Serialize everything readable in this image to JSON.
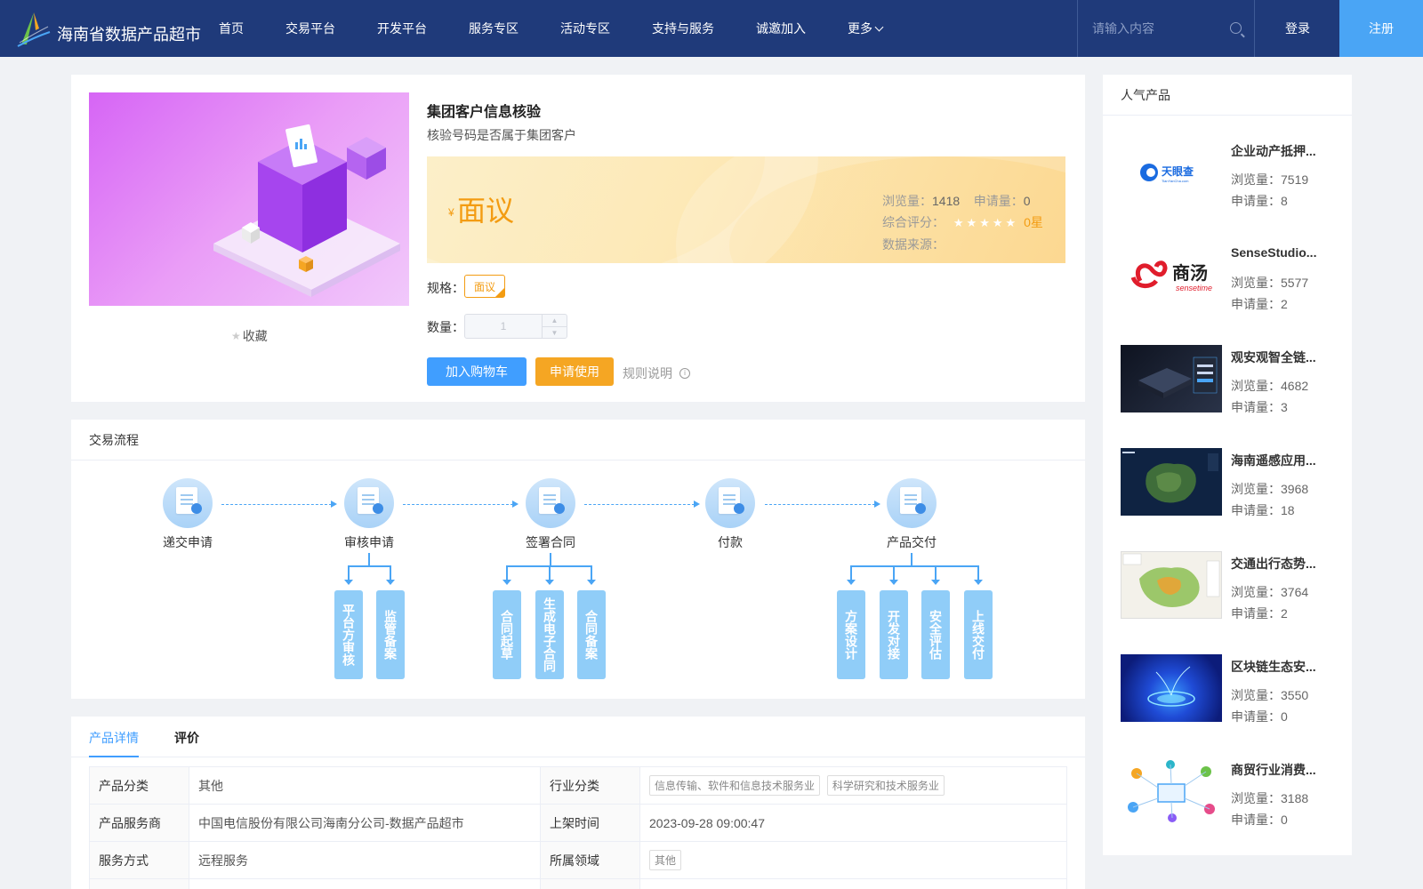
{
  "header": {
    "site_name": "海南省数据产品超市",
    "nav": [
      "首页",
      "交易平台",
      "开发平台",
      "服务专区",
      "活动专区",
      "支持与服务",
      "诚邀加入",
      "更多"
    ],
    "search_placeholder": "请输入内容",
    "login": "登录",
    "register": "注册"
  },
  "product": {
    "title": "集团客户信息核验",
    "subtitle": "核验号码是否属于集团客户",
    "favorite": "收藏",
    "price_symbol": "¥",
    "price": "面议",
    "views_label": "浏览量：",
    "views": "1418",
    "applies_label": "申请量：",
    "applies": "0",
    "rating_label": "综合评分：",
    "stars": "★★★★★",
    "rating": "0星",
    "source_label": "数据来源：",
    "spec_label": "规格：",
    "spec_value": "面议",
    "qty_label": "数量：",
    "qty_value": "1",
    "add_cart": "加入购物车",
    "apply": "申请使用",
    "rules": "规则说明"
  },
  "process": {
    "title": "交易流程",
    "steps": [
      "递交申请",
      "审核申请",
      "签署合同",
      "付款",
      "产品交付"
    ],
    "sub_steps": {
      "review": [
        "平台方审核",
        "监管备案"
      ],
      "contract": [
        "合同起草",
        "生成电子合同",
        "合同备案"
      ],
      "delivery": [
        "方案设计",
        "开发对接",
        "安全评估",
        "上线交付"
      ]
    }
  },
  "details": {
    "tabs": [
      "产品详情",
      "评价"
    ],
    "rows": [
      {
        "k1": "产品分类",
        "v1": "其他",
        "k2": "行业分类",
        "tags2": [
          "信息传输、软件和信息技术服务业",
          "科学研究和技术服务业"
        ]
      },
      {
        "k1": "产品服务商",
        "v1": "中国电信股份有限公司海南分公司-数据产品超市",
        "k2": "上架时间",
        "v2": "2023-09-28 09:00:47"
      },
      {
        "k1": "服务方式",
        "v1": "远程服务",
        "k2": "所属领域",
        "tags2": [
          "其他"
        ]
      }
    ]
  },
  "sidebar": {
    "title": "人气产品",
    "items": [
      {
        "name": "企业动产抵押...",
        "views": "浏览量：7519",
        "applies": "申请量：8",
        "logo_text": "天眼查",
        "logo_sub": "TianYanCha.com"
      },
      {
        "name": "SenseStudio...",
        "views": "浏览量：5577",
        "applies": "申请量：2",
        "logo_text": "商汤",
        "logo_sub": "sensetime"
      },
      {
        "name": "观安观智全链...",
        "views": "浏览量：4682",
        "applies": "申请量：3"
      },
      {
        "name": "海南遥感应用...",
        "views": "浏览量：3968",
        "applies": "申请量：18"
      },
      {
        "name": "交通出行态势...",
        "views": "浏览量：3764",
        "applies": "申请量：2"
      },
      {
        "name": "区块链生态安...",
        "views": "浏览量：3550",
        "applies": "申请量：0"
      },
      {
        "name": "商贸行业消费...",
        "views": "浏览量：3188",
        "applies": "申请量：0"
      }
    ]
  },
  "colors": {
    "header_bg": "#1f3a7a",
    "accent_blue": "#409eff",
    "accent_orange": "#f5a623",
    "register_bg": "#4aa5f5"
  }
}
